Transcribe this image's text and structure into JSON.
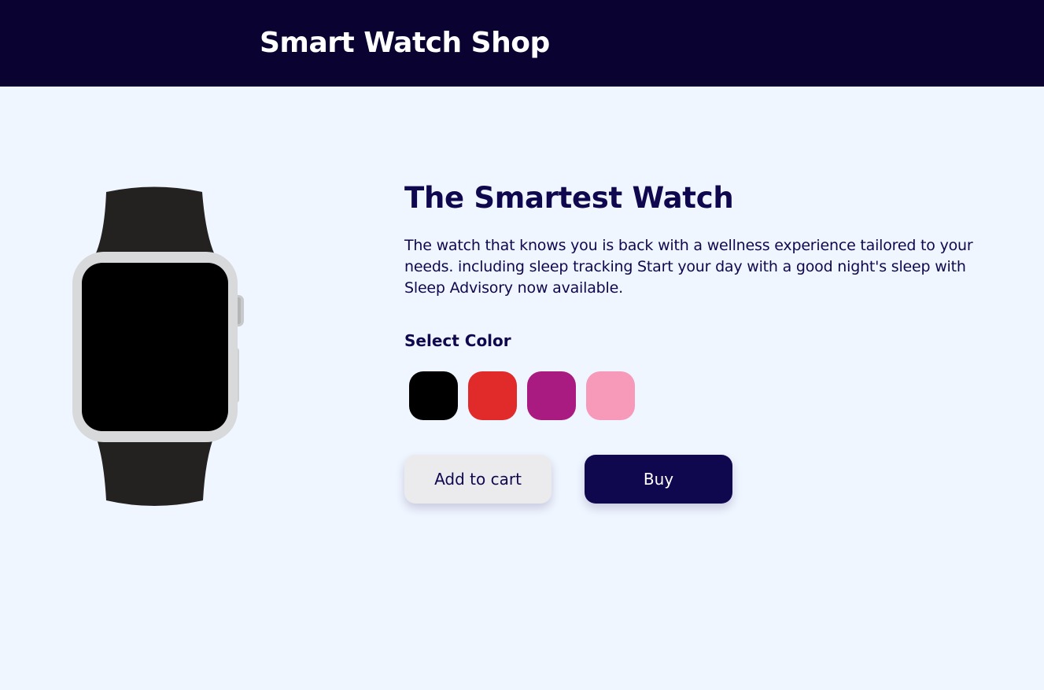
{
  "header": {
    "title": "Smart Watch Shop"
  },
  "product": {
    "image_icon": "smartwatch-image",
    "title": "The Smartest Watch",
    "description": "The watch that knows you is back with a wellness experience tailored to your needs. including sleep tracking Start your day with a good night's sleep with Sleep Advisory now available."
  },
  "color_selector": {
    "label": "Select Color",
    "options": [
      {
        "name": "black",
        "hex": "#000000"
      },
      {
        "name": "red",
        "hex": "#e12a2a"
      },
      {
        "name": "magenta",
        "hex": "#a91b80"
      },
      {
        "name": "pink",
        "hex": "#f799b8"
      }
    ]
  },
  "actions": {
    "add_to_cart_label": "Add to cart",
    "buy_label": "Buy"
  },
  "colors": {
    "header_bg": "#0a0230",
    "page_bg": "#f0f6ff",
    "primary": "#10084f",
    "secondary_button": "#ebebee",
    "watch_band": "#242220",
    "watch_case": "#d8d9da",
    "watch_screen": "#000000"
  }
}
